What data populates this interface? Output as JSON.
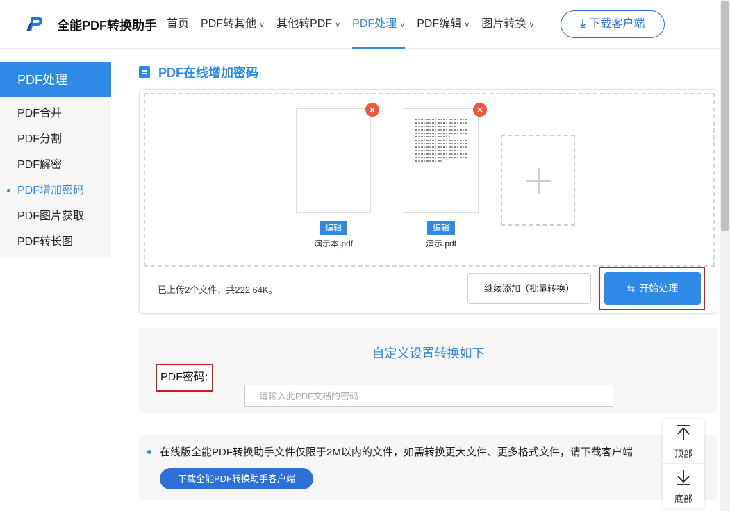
{
  "header": {
    "brand": "全能PDF转换助手",
    "logo_icon": "pdf-p-logo",
    "nav": [
      {
        "label": "首页",
        "dropdown": false,
        "active": false
      },
      {
        "label": "PDF转其他",
        "dropdown": true,
        "active": false
      },
      {
        "label": "其他转PDF",
        "dropdown": true,
        "active": false
      },
      {
        "label": "PDF处理",
        "dropdown": true,
        "active": true
      },
      {
        "label": "PDF编辑",
        "dropdown": true,
        "active": false
      },
      {
        "label": "图片转换",
        "dropdown": true,
        "active": false
      }
    ],
    "download_label": "下载客户端",
    "download_icon": "download-icon"
  },
  "sidebar": {
    "title": "PDF处理",
    "items": [
      {
        "label": "PDF合并",
        "active": false
      },
      {
        "label": "PDF分割",
        "active": false
      },
      {
        "label": "PDF解密",
        "active": false
      },
      {
        "label": "PDF增加密码",
        "active": true
      },
      {
        "label": "PDF图片获取",
        "active": false
      },
      {
        "label": "PDF转长图",
        "active": false
      }
    ]
  },
  "main": {
    "title": "PDF在线增加密码",
    "files": [
      {
        "name": "演示本.pdf",
        "edit_label": "编辑",
        "remove_icon": "close-icon"
      },
      {
        "name": "演示.pdf",
        "edit_label": "编辑",
        "remove_icon": "close-icon"
      }
    ],
    "upload_status": "已上传2个文件，共222.64K。",
    "continue_label": "继续添加（批量转换）",
    "start_label": "开始处理",
    "start_icon": "swap-icon"
  },
  "settings": {
    "title": "自定义设置转换如下",
    "password_label": "PDF密码:",
    "password_placeholder": "请输入此PDF文档的密码",
    "password_value": ""
  },
  "notice": {
    "text": "在线版全能PDF转换助手文件仅限于2M以内的文件，如需转换更大文件、更多格式文件，请下载客户端",
    "button_label": "下载全能PDF转换助手客户端"
  },
  "float_widget": {
    "top_label": "顶部",
    "bottom_label": "底部"
  },
  "colors": {
    "accent": "#2e8ae6",
    "highlight_outline": "#e0171b",
    "remove": "#f0573d"
  }
}
